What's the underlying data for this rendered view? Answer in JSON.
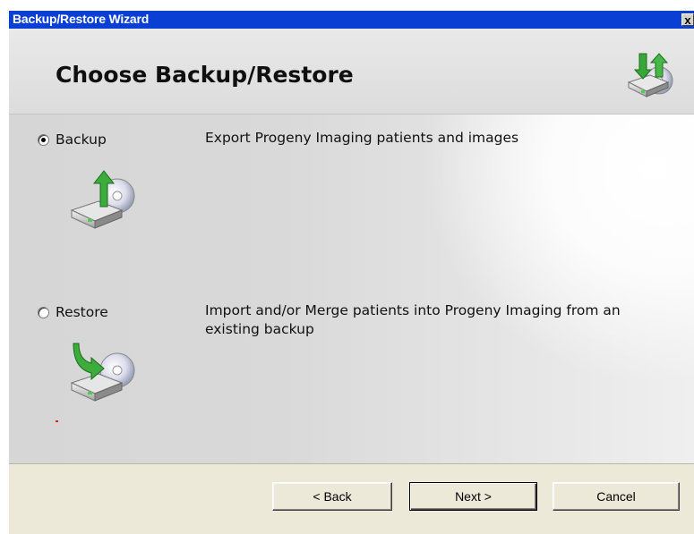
{
  "window": {
    "title": "Backup/Restore Wizard",
    "close_glyph": "x"
  },
  "header": {
    "title": "Choose Backup/Restore",
    "icon": "backup-restore-drive-icon"
  },
  "options": [
    {
      "label": "Backup",
      "selected": true,
      "description": "Export Progeny Imaging patients and images",
      "icon": "backup-drive-icon"
    },
    {
      "label": "Restore",
      "selected": false,
      "description": "Import and/or Merge patients into Progeny Imaging from an existing backup",
      "icon": "restore-drive-icon"
    }
  ],
  "buttons": {
    "back": "< Back",
    "next": "Next >",
    "cancel": "Cancel"
  },
  "colors": {
    "titlebar": "#0a3fd4",
    "footer": "#ece9d8",
    "arrow_green": "#3aa83a"
  }
}
